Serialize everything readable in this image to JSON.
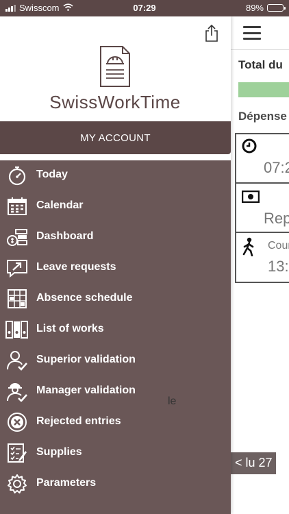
{
  "status_bar": {
    "carrier": "Swisscom",
    "time": "07:29",
    "battery": "89%",
    "battery_level": 0.89
  },
  "drawer": {
    "app_name": "SwissWorkTime",
    "account_button": "MY ACCOUNT",
    "menu": [
      {
        "label": "Today",
        "icon": "stopwatch-icon"
      },
      {
        "label": "Calendar",
        "icon": "calendar-icon"
      },
      {
        "label": "Dashboard",
        "icon": "dashboard-icon"
      },
      {
        "label": "Leave requests",
        "icon": "leave-request-icon"
      },
      {
        "label": "Absence schedule",
        "icon": "absence-schedule-icon"
      },
      {
        "label": "List of works",
        "icon": "binders-icon"
      },
      {
        "label": "Superior validation",
        "icon": "user-check-icon"
      },
      {
        "label": "Manager validation",
        "icon": "worker-check-icon"
      },
      {
        "label": "Rejected entries",
        "icon": "rejected-icon"
      },
      {
        "label": "Supplies",
        "icon": "supplies-icon"
      },
      {
        "label": "Parameters",
        "icon": "gear-icon"
      }
    ]
  },
  "background": {
    "total_label": "Total du",
    "expenses_label": "Dépense",
    "cards": [
      {
        "icon": "clock-icon",
        "text": "07:2"
      },
      {
        "icon": "cash-icon",
        "text": "Rep"
      },
      {
        "icon": "walking-icon",
        "text": "Cour",
        "subtext": "13:1"
      }
    ],
    "stray_text": "le",
    "date_tag": "< lu 27"
  },
  "colors": {
    "brand": "#5b4747",
    "menu_bg": "#6a5757",
    "progress_green": "#9ed19a"
  }
}
